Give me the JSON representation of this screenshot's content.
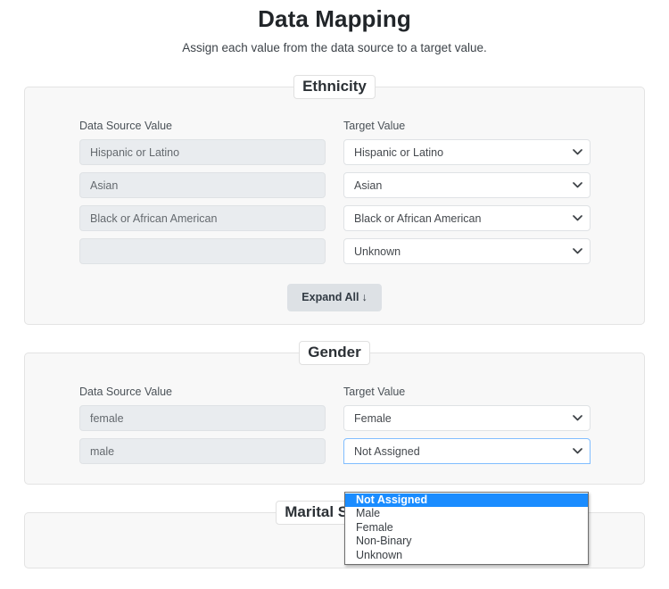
{
  "header": {
    "title": "Data Mapping",
    "subtitle": "Assign each value from the data source to a target value."
  },
  "labels": {
    "source": "Data Source Value",
    "target": "Target Value"
  },
  "buttons": {
    "expand_all": "Expand All",
    "expand_all_arrow": "↓"
  },
  "icons": {
    "chevron_down": "chevron-down-icon"
  },
  "colors": {
    "highlight": "#1a8cff",
    "focus_border": "#80bdff",
    "section_bg": "#f8f8f8",
    "input_bg": "#e9ecef",
    "button_bg": "#dde1e5"
  },
  "sections": [
    {
      "legend": "Ethnicity",
      "rows": [
        {
          "source": "Hispanic or Latino",
          "target": "Hispanic or Latino"
        },
        {
          "source": "Asian",
          "target": "Asian"
        },
        {
          "source": "Black or African American",
          "target": "Black or African American"
        },
        {
          "source": "",
          "target": "Unknown"
        }
      ],
      "has_expand_all": true
    },
    {
      "legend": "Gender",
      "rows": [
        {
          "source": "female",
          "target": "Female"
        },
        {
          "source": "male",
          "target": "Not Assigned"
        }
      ],
      "has_expand_all": false
    },
    {
      "legend": "Marital Status",
      "rows": [],
      "has_expand_all": false
    }
  ],
  "open_dropdown": {
    "owner_section": "Gender",
    "owner_row": 1,
    "selected": "Not Assigned",
    "options": [
      "Not Assigned",
      "Male",
      "Female",
      "Non-Binary",
      "Unknown"
    ]
  }
}
